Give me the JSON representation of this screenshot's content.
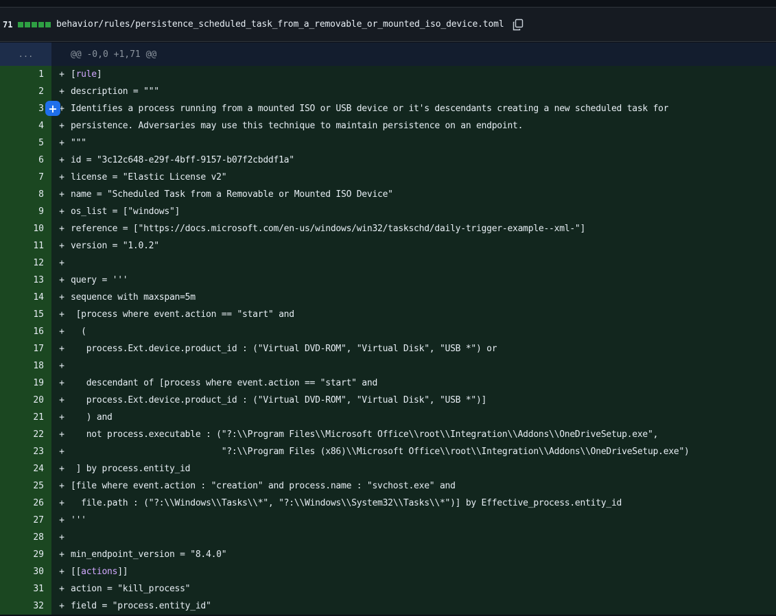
{
  "file": {
    "additions": "71",
    "path": "behavior/rules/persistence_scheduled_task_from_a_removable_or_mounted_iso_device.toml",
    "copy_icon": "copy-icon"
  },
  "hunk": {
    "expander": "...",
    "header": "@@ -0,0 +1,71 @@"
  },
  "add_marker": "+",
  "add_line_button": "+",
  "lines": [
    {
      "n": "1",
      "pre": "[",
      "kw": "rule",
      "post": "]"
    },
    {
      "n": "2",
      "text": "description = \"\"\""
    },
    {
      "n": "3",
      "text": "Identifies a process running from a mounted ISO or USB device or it's descendants creating a new scheduled task for"
    },
    {
      "n": "4",
      "text": "persistence. Adversaries may use this technique to maintain persistence on an endpoint."
    },
    {
      "n": "5",
      "text": "\"\"\""
    },
    {
      "n": "6",
      "text": "id = \"3c12c648-e29f-4bff-9157-b07f2cbddf1a\""
    },
    {
      "n": "7",
      "text": "license = \"Elastic License v2\""
    },
    {
      "n": "8",
      "text": "name = \"Scheduled Task from a Removable or Mounted ISO Device\""
    },
    {
      "n": "9",
      "text": "os_list = [\"windows\"]"
    },
    {
      "n": "10",
      "text": "reference = [\"https://docs.microsoft.com/en-us/windows/win32/taskschd/daily-trigger-example--xml-\"]"
    },
    {
      "n": "11",
      "text": "version = \"1.0.2\""
    },
    {
      "n": "12",
      "text": ""
    },
    {
      "n": "13",
      "text": "query = '''"
    },
    {
      "n": "14",
      "text": "sequence with maxspan=5m"
    },
    {
      "n": "15",
      "text": " [process where event.action == \"start\" and"
    },
    {
      "n": "16",
      "text": "  ("
    },
    {
      "n": "17",
      "text": "   process.Ext.device.product_id : (\"Virtual DVD-ROM\", \"Virtual Disk\", \"USB *\") or"
    },
    {
      "n": "18",
      "text": ""
    },
    {
      "n": "19",
      "text": "   descendant of [process where event.action == \"start\" and"
    },
    {
      "n": "20",
      "text": "   process.Ext.device.product_id : (\"Virtual DVD-ROM\", \"Virtual Disk\", \"USB *\")]"
    },
    {
      "n": "21",
      "text": "   ) and"
    },
    {
      "n": "22",
      "text": "   not process.executable : (\"?:\\\\Program Files\\\\Microsoft Office\\\\root\\\\Integration\\\\Addons\\\\OneDriveSetup.exe\","
    },
    {
      "n": "23",
      "text": "                             \"?:\\\\Program Files (x86)\\\\Microsoft Office\\\\root\\\\Integration\\\\Addons\\\\OneDriveSetup.exe\")"
    },
    {
      "n": "24",
      "text": " ] by process.entity_id"
    },
    {
      "n": "25",
      "text": "[file where event.action : \"creation\" and process.name : \"svchost.exe\" and"
    },
    {
      "n": "26",
      "text": "  file.path : (\"?:\\\\Windows\\\\Tasks\\\\*\", \"?:\\\\Windows\\\\System32\\\\Tasks\\\\*\")] by Effective_process.entity_id"
    },
    {
      "n": "27",
      "text": "'''"
    },
    {
      "n": "28",
      "text": ""
    },
    {
      "n": "29",
      "text": "min_endpoint_version = \"8.4.0\""
    },
    {
      "n": "30",
      "pre": "[[",
      "kw": "actions",
      "post": "]]"
    },
    {
      "n": "31",
      "text": "action = \"kill_process\""
    },
    {
      "n": "32",
      "text": "field = \"process.entity_id\""
    }
  ]
}
